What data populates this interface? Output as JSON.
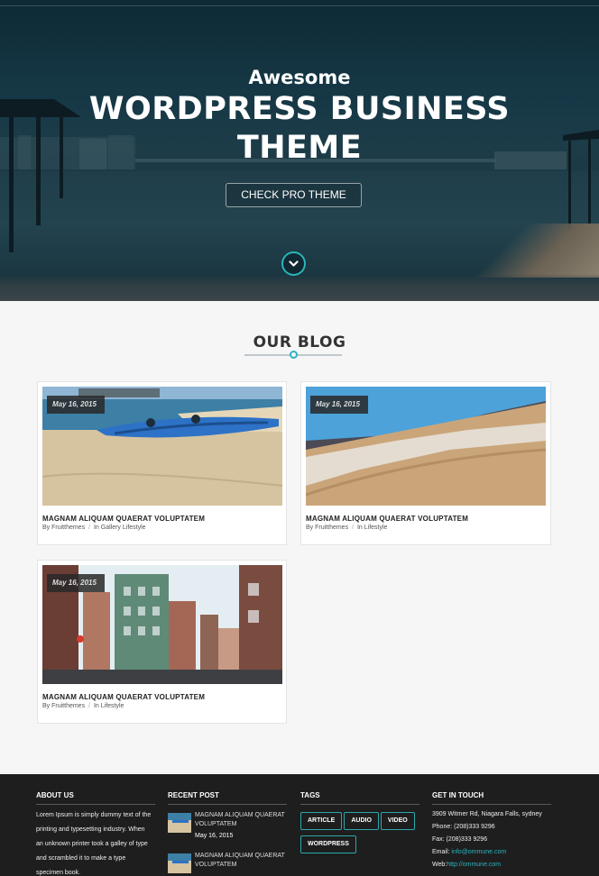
{
  "hero": {
    "subtitle": "Awesome",
    "title_line1": "WORDPRESS BUSINESS",
    "title_line2": "THEME",
    "cta_label": "CHECK PRO THEME",
    "scroll_icon": "chevron-down-icon",
    "accent_color": "#29b5b8"
  },
  "blog": {
    "heading": "OUR BLOG",
    "posts": [
      {
        "date": "May 16, 2015",
        "title": "MAGNAM ALIQUAM QUAERAT VOLUPTATEM",
        "by_label": "By",
        "author": "Fruitthemes",
        "in_label": "In",
        "categories": "Gallery  Lifestyle",
        "image": "beach-kayak"
      },
      {
        "date": "May 16, 2015",
        "title": "MAGNAM ALIQUAM QUAERAT VOLUPTATEM",
        "by_label": "By",
        "author": "Fruitthemes",
        "in_label": "In",
        "categories": "Lifestyle",
        "image": "sand-dune"
      },
      {
        "date": "May 16, 2015",
        "title": "MAGNAM ALIQUAM QUAERAT VOLUPTATEM",
        "by_label": "By",
        "author": "Fruitthemes",
        "in_label": "In",
        "categories": "Lifestyle",
        "image": "city-street"
      }
    ]
  },
  "footer": {
    "about": {
      "heading": "ABOUT US",
      "text": "Lorem Ipsum is simply dummy text of the printing and typesetting industry. When an unknown printer took a galley of type and scrambled it to make a type specimen book."
    },
    "recent": {
      "heading": "RECENT POST",
      "items": [
        {
          "title": "MAGNAM ALIQUAM QUAERAT VOLUPTATEM",
          "date": "May 16, 2015"
        },
        {
          "title": "MAGNAM ALIQUAM QUAERAT VOLUPTATEM",
          "date": ""
        }
      ]
    },
    "tags": {
      "heading": "TAGS",
      "items": [
        "ARTICLE",
        "AUDIO",
        "VIDEO",
        "WORDPRESS"
      ]
    },
    "contact": {
      "heading": "GET IN TOUCH",
      "address": "3909 Witmer Rd, Niagara Falls, sydney",
      "phone": "Phone: (208)333 9296",
      "fax": "Fax: (208)333 9296",
      "email_label": "Email:",
      "email": "info@ommune.com",
      "web_label": "Web:",
      "web": "http://ommune.com"
    }
  }
}
